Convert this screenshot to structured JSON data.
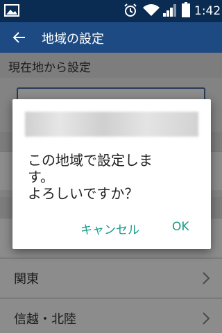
{
  "status_bar": {
    "time": "1:42",
    "icons": [
      "gallery-icon",
      "alarm-icon",
      "wifi-icon",
      "signal-icon",
      "battery-icon"
    ]
  },
  "app_bar": {
    "title": "地域の設定",
    "back_icon": "back-arrow-icon"
  },
  "sections": {
    "current_location_header": "現在地から設定"
  },
  "regions": [
    {
      "label": "関東"
    },
    {
      "label": "信越・北陸"
    }
  ],
  "dialog": {
    "message": "この地域で設定しま\nす。\nよろしいですか？",
    "cancel_label": "キャンセル",
    "ok_label": "OK"
  },
  "colors": {
    "status_bar": "#0a2c52",
    "app_bar": "#1d4a82",
    "dialog_button": "#169a8c"
  }
}
